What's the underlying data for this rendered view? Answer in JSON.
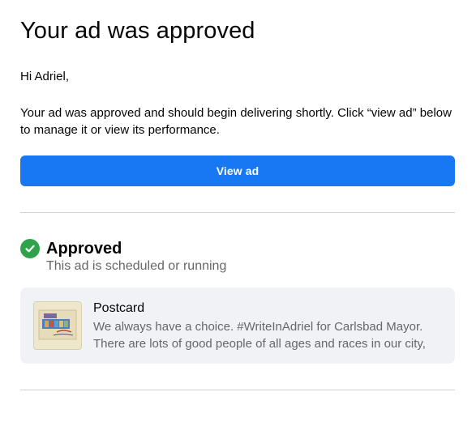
{
  "email": {
    "title": "Your ad was approved",
    "greeting": "Hi Adriel,",
    "body": "Your ad was approved and should begin delivering shortly. Click “view ad” below to manage it or view its performance.",
    "view_ad_label": "View ad"
  },
  "status": {
    "icon": "check-circle-icon",
    "title": "Approved",
    "subtitle": "This ad is scheduled or running"
  },
  "ad": {
    "name": "Postcard",
    "description": "We always have a choice. #WriteInAdriel for Carlsbad Mayor. There are lots of good people of all ages and races in our city, who share"
  },
  "colors": {
    "button": "#1877f2",
    "success": "#31a24c",
    "card_background": "#f0f2f5",
    "muted_text": "#65676b"
  }
}
